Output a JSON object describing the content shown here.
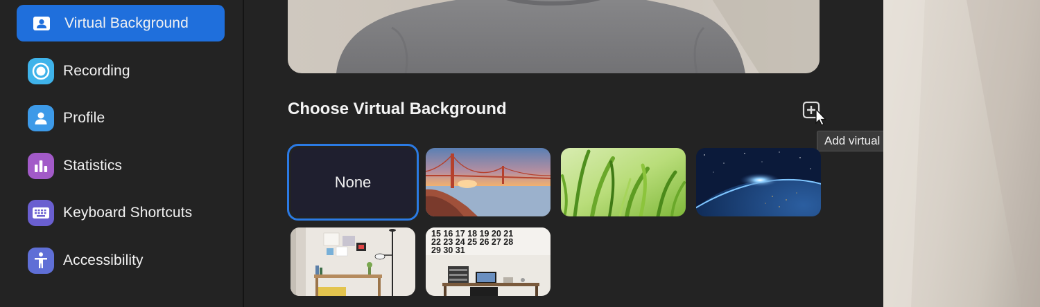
{
  "sidebar": {
    "items": [
      {
        "label": "Virtual Background",
        "icon": "virtual-background-icon",
        "active": true,
        "color": "#1f6fdc"
      },
      {
        "label": "Recording",
        "icon": "recording-icon",
        "active": false,
        "color": "#3fb3ea"
      },
      {
        "label": "Profile",
        "icon": "profile-icon",
        "active": false,
        "color": "#3d9ae8"
      },
      {
        "label": "Statistics",
        "icon": "statistics-icon",
        "active": false,
        "color": "#a25ac8"
      },
      {
        "label": "Keyboard Shortcuts",
        "icon": "keyboard-icon",
        "active": false,
        "color": "#6a5fd0"
      },
      {
        "label": "Accessibility",
        "icon": "accessibility-icon",
        "active": false,
        "color": "#5f6fd6"
      }
    ]
  },
  "main": {
    "section_title": "Choose Virtual Background",
    "add_button_icon": "add-image-icon",
    "tooltip": "Add virtual background image",
    "backgrounds": [
      {
        "label": "None",
        "selected": true
      },
      {
        "image": "golden-gate-bridge",
        "selected": false
      },
      {
        "image": "grass",
        "selected": false
      },
      {
        "image": "earth-from-space",
        "selected": false
      },
      {
        "image": "room-with-lamp",
        "selected": false
      },
      {
        "image": "office-with-calendar",
        "selected": false
      }
    ],
    "calendar_rows": [
      "15 16 17 18 19 20 21",
      "22 23 24 25 26 27 28",
      "29 30 31"
    ]
  },
  "colors": {
    "accent": "#1f6fdc",
    "selected_border": "#2b7ae4",
    "panel_bg": "#232323"
  }
}
